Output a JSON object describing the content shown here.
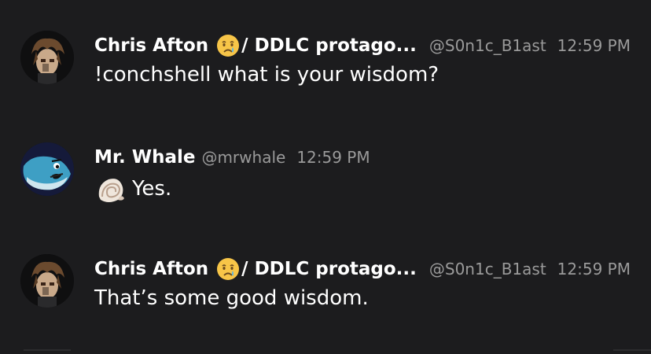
{
  "messages": [
    {
      "display_name": "Chris Afton",
      "name_suffix": "/ DDLC protago...",
      "username": "@S0n1c_B1ast",
      "timestamp": "12:59 PM",
      "content": "!conchshell what is your wisdom?",
      "avatar_icon": "brown-haired-character-avatar",
      "name_emoji": "crying-face-emoji"
    },
    {
      "display_name": "Mr. Whale",
      "username": "@mrwhale",
      "timestamp": "12:59 PM",
      "content": "Yes.",
      "avatar_icon": "blue-whale-avatar",
      "content_emoji": "spiral-shell-emoji"
    },
    {
      "display_name": "Chris Afton",
      "name_suffix": "/ DDLC protago...",
      "username": "@S0n1c_B1ast",
      "timestamp": "12:59 PM",
      "content": "That’s some good wisdom.",
      "avatar_icon": "brown-haired-character-avatar",
      "name_emoji": "crying-face-emoji"
    }
  ],
  "colors": {
    "background": "#1c1c1e",
    "text": "#ffffff",
    "muted": "#9a9a9a",
    "whale_blue": "#3e9fc4"
  }
}
